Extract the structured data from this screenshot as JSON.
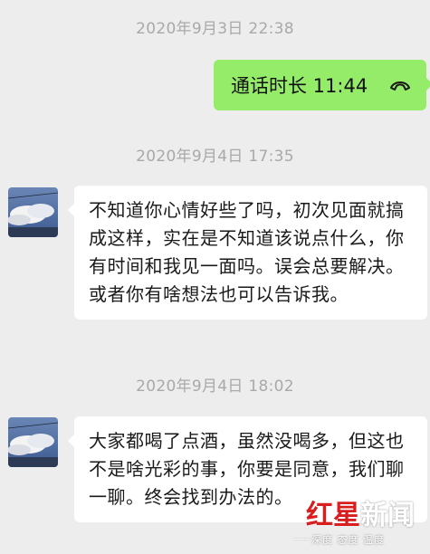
{
  "messages": [
    {
      "type": "timestamp",
      "text": "2020年9月3日 22:38"
    },
    {
      "type": "call",
      "text": "通话时长 11:44",
      "icon": "phone-hangup-icon"
    },
    {
      "type": "timestamp",
      "text": "2020年9月4日 17:35"
    },
    {
      "type": "incoming",
      "text": "不知道你心情好些了吗，初次见面就搞成这样，实在是不知道该说点什么，你有时间和我见一面吗。误会总要解决。或者你有啥想法也可以告诉我。"
    },
    {
      "type": "timestamp",
      "text": "2020年9月4日 18:02"
    },
    {
      "type": "incoming",
      "text": "大家都喝了点酒，虽然没喝多，但这也不是啥光彩的事，你要是同意，我们聊一聊。终会找到办法的。"
    }
  ],
  "watermark": {
    "logo_red": "红星",
    "logo_white": "新闻",
    "slogan": "深度 态度 温度"
  },
  "colors": {
    "background": "#ededed",
    "outgoing_bubble": "#95ec69",
    "incoming_bubble": "#ffffff",
    "timestamp": "#a9a9a9",
    "brand_red": "#d81e1e"
  }
}
